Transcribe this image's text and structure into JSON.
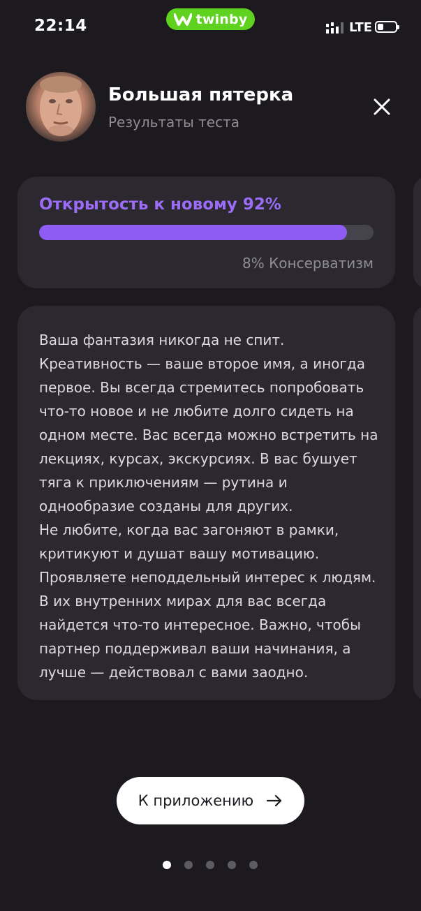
{
  "status_bar": {
    "time": "22:14",
    "brand": "twinby",
    "network": "LTE",
    "icons": [
      "signal-icon",
      "battery-icon"
    ]
  },
  "header": {
    "title": "Большая пятерка",
    "subtitle": "Результаты теста",
    "close_icon": "close-icon"
  },
  "score": {
    "trait": "Открытость к новому 92%",
    "percent": 92,
    "opposite": "8% Консерватизм"
  },
  "description": {
    "paragraphs": [
      "Ваша фантазия никогда не спит. Креативность — ваше второе имя, а иногда первое. Вы всегда стремитесь попробовать что-то новое и не любите долго сидеть на одном месте. Вас всегда можно встретить на лекциях, курсах, экскурсиях. В вас бушует тяга к приключениям — рутина и однообразие созданы для других.",
      "Не любите, когда вас загоняют в рамки, критикуют и душат вашу мотивацию. Проявляете неподдельный интерес к людям. В их внутренних мирах для вас всегда найдется что-то интересное. Важно, чтобы партнер поддерживал ваши начинания, а лучше — действовал с вами заодно."
    ]
  },
  "cta": {
    "label": "К приложению",
    "icon": "arrow-right-icon"
  },
  "pager": {
    "total": 5,
    "active": 1
  },
  "colors": {
    "background": "#1c1a1f",
    "card": "#2b292f",
    "accent": "#8e5cf2",
    "brand": "#5fd21f"
  }
}
